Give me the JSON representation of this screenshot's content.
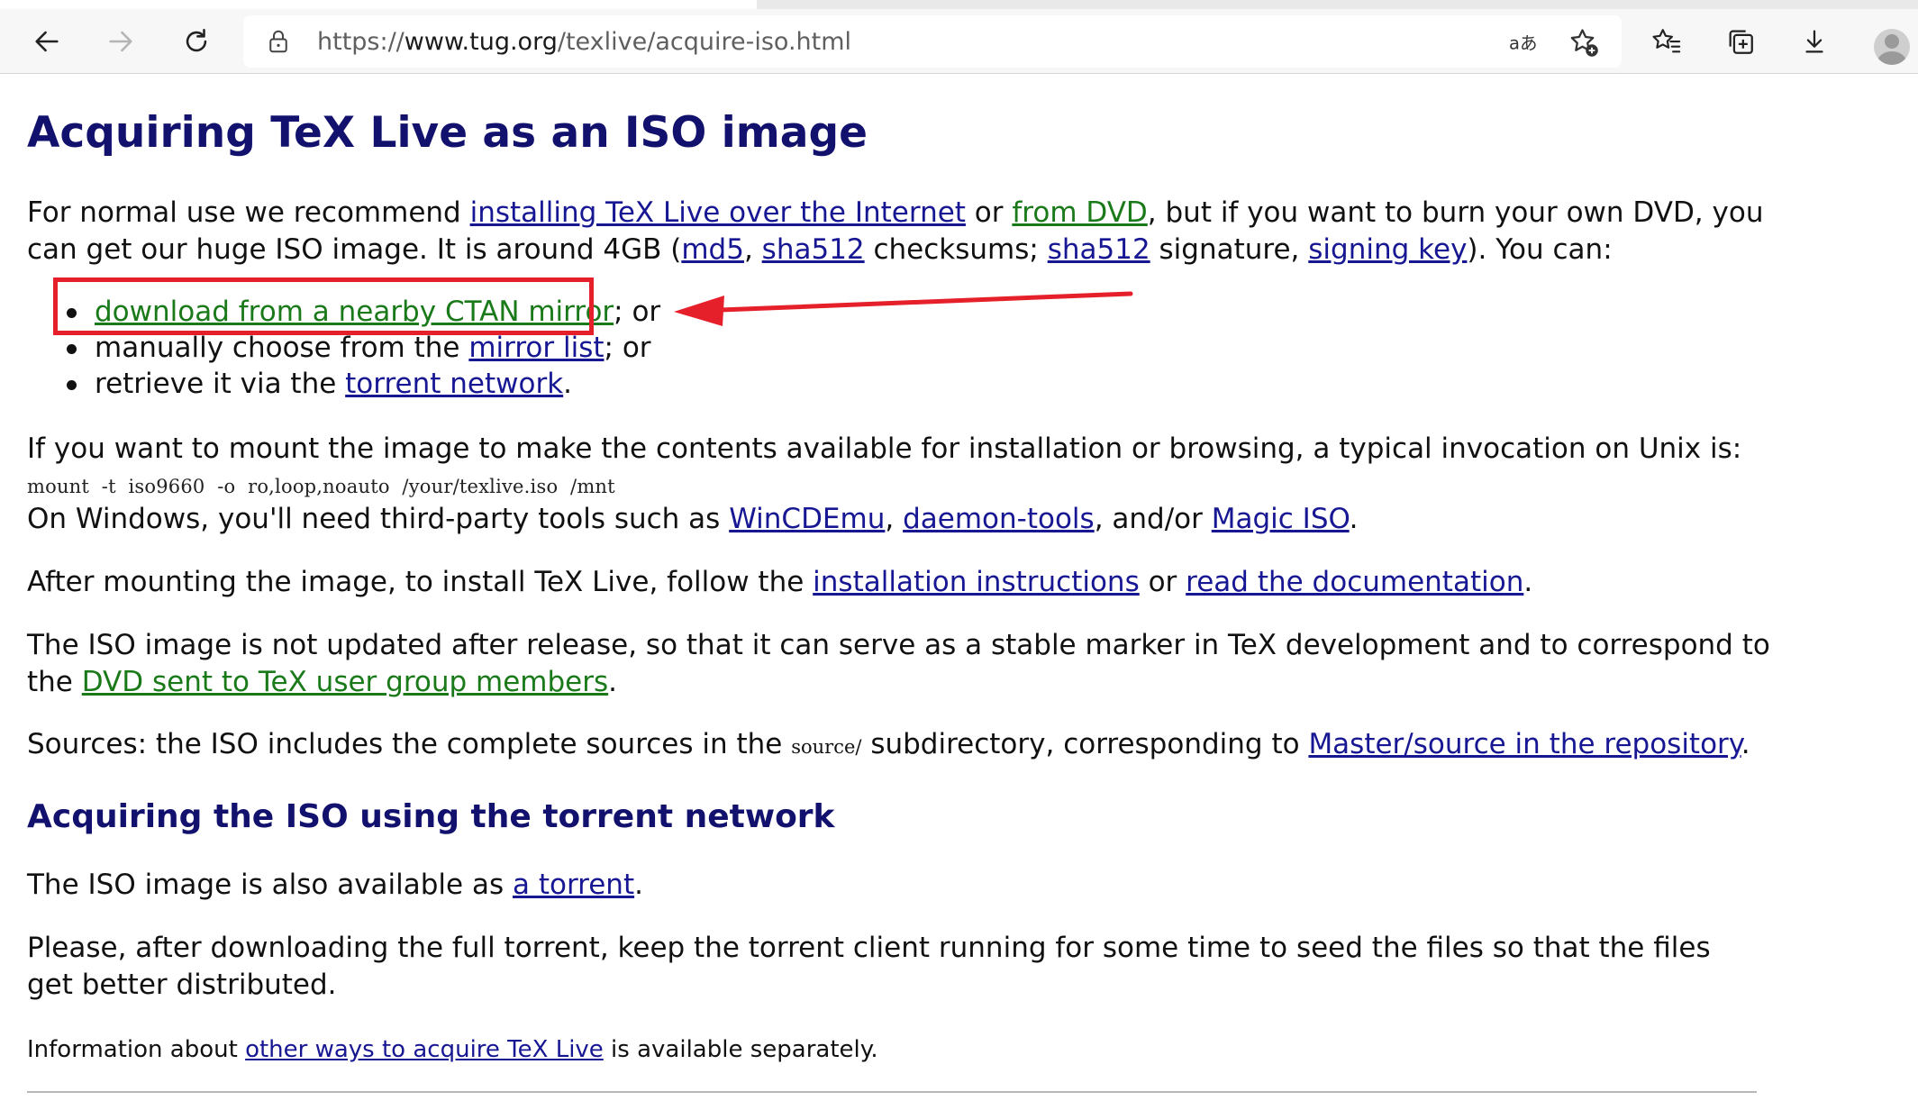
{
  "browser": {
    "url_scheme": "https://",
    "url_host": "www.tug.org",
    "url_path": "/texlive/acquire-iso.html"
  },
  "page": {
    "title": "Acquiring TeX Live as an ISO image",
    "intro": {
      "t1": "For normal use we recommend ",
      "link_internet": "installing TeX Live over the Internet",
      "t2": " or ",
      "link_dvd": "from DVD",
      "t3": ", but if you want to burn your own DVD, you can get our huge ISO image. It is around 4GB (",
      "link_md5": "md5",
      "t4": ", ",
      "link_sha512": "sha512",
      "t5": " checksums; ",
      "link_sha512_sig": "sha512",
      "t6": " signature, ",
      "link_signing_key": "signing key",
      "t7": "). You can:"
    },
    "choices": [
      {
        "pre": "",
        "link": "download from a nearby CTAN mirror",
        "post": "; or"
      },
      {
        "pre": "manually choose from the ",
        "link": "mirror list",
        "post": "; or"
      },
      {
        "pre": "retrieve it via the ",
        "link": "torrent network",
        "post": "."
      }
    ],
    "mount": {
      "text": "If you want to mount the image to make the contents available for installation or browsing, a typical invocation on Unix is:",
      "command": "mount  -t  iso9660  -o  ro,loop,noauto  /your/texlive.iso  /mnt",
      "windows_t1": "On Windows, you'll need third-party tools such as ",
      "link_wincdemu": "WinCDEmu",
      "windows_t2": ", ",
      "link_daemon": "daemon-tools",
      "windows_t3": ", and/or ",
      "link_magiciso": "Magic ISO",
      "windows_t4": "."
    },
    "after_mount": {
      "t1": "After mounting the image, to install TeX Live, follow the ",
      "link_install": "installation instructions",
      "t2": " or ",
      "link_doc": "read the documentation",
      "t3": "."
    },
    "not_updated": {
      "t1": "The ISO image is not updated after release, so that it can serve as a stable marker in TeX development and to correspond to the ",
      "link_dvd_members": "DVD sent to TeX user group members",
      "t2": "."
    },
    "sources": {
      "t1": "Sources: the ISO includes the complete sources in the ",
      "code": "source/",
      "t2": " subdirectory, corresponding to ",
      "link_repo": "Master/source in the repository",
      "t3": "."
    },
    "torrent_heading": "Acquiring the ISO using the torrent network",
    "torrent_para": {
      "t1": "The ISO image is also available as ",
      "link_torrent": "a torrent",
      "t2": "."
    },
    "seed_para": "Please, after downloading the full torrent, keep the torrent client running for some time to seed the files so that the files get better distributed.",
    "info": {
      "t1": "Information about ",
      "link_other": "other ways to acquire TeX Live",
      "t2": " is available separately."
    }
  },
  "colors": {
    "heading": "#12126e",
    "link_blue": "#171794",
    "link_green": "#1a7a1a",
    "annotation_red": "#e6202a"
  },
  "icons": [
    "back-arrow-icon",
    "forward-arrow-icon",
    "refresh-icon",
    "lock-icon",
    "read-aloud-icon",
    "add-favorite-icon",
    "favorites-icon",
    "collections-icon",
    "download-icon",
    "profile-avatar"
  ]
}
